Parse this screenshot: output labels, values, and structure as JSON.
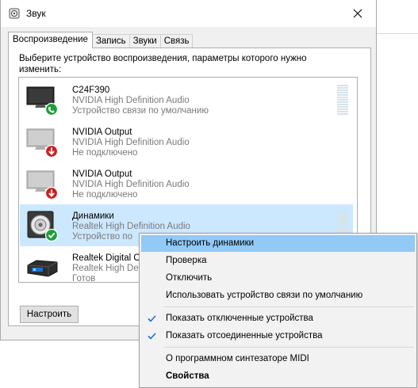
{
  "window": {
    "title": "Звук"
  },
  "tabs": [
    {
      "label": "Воспроизведение",
      "active": true
    },
    {
      "label": "Запись",
      "active": false
    },
    {
      "label": "Звуки",
      "active": false
    },
    {
      "label": "Связь",
      "active": false
    }
  ],
  "panel": {
    "instruction": "Выберите устройство воспроизведения, параметры которого нужно изменить:",
    "configure_label": "Настроить"
  },
  "devices": [
    {
      "name": "C24F390",
      "description": "NVIDIA High Definition Audio",
      "status": "Устройство связи по умолчанию",
      "icon": "monitor-icon",
      "badge": "phone-check",
      "selected": false
    },
    {
      "name": "NVIDIA Output",
      "description": "NVIDIA High Definition Audio",
      "status": "Не подключено",
      "icon": "monitor-icon",
      "badge": "down-arrow",
      "selected": false
    },
    {
      "name": "NVIDIA Output",
      "description": "NVIDIA High Definition Audio",
      "status": "Не подключено",
      "icon": "monitor-icon",
      "badge": "down-arrow",
      "selected": false
    },
    {
      "name": "Динамики",
      "description": "Realtek High Definition Audio",
      "status": "Устройство по",
      "icon": "speaker-icon",
      "badge": "check",
      "selected": true
    },
    {
      "name": "Realtek Digital O",
      "description": "Realtek High Definit",
      "status": "Готов",
      "icon": "digital-output-icon",
      "badge": "none",
      "selected": false
    }
  ],
  "context_menu": {
    "items": [
      {
        "label": "Настроить динамики",
        "checked": false,
        "bold": false,
        "highlighted": true
      },
      {
        "label": "Проверка",
        "checked": false,
        "bold": false,
        "highlighted": false
      },
      {
        "label": "Отключить",
        "checked": false,
        "bold": false,
        "highlighted": false
      },
      {
        "label": "Использовать устройство связи по умолчанию",
        "checked": false,
        "bold": false,
        "highlighted": false
      },
      {
        "label": "Показать отключенные устройства",
        "checked": true,
        "bold": false,
        "highlighted": false
      },
      {
        "label": "Показать отсоединенные устройства",
        "checked": true,
        "bold": false,
        "highlighted": false
      },
      {
        "label": "О программном синтезаторе MIDI",
        "checked": false,
        "bold": false,
        "highlighted": false
      },
      {
        "label": "Свойства",
        "checked": false,
        "bold": true,
        "highlighted": false
      }
    ]
  },
  "colors": {
    "selection": "#cce8ff",
    "menu_highlight": "#91c9f7",
    "badge_green": "#1e9e3a",
    "badge_red": "#cc1f1f",
    "check_blue": "#1f6fd0"
  }
}
